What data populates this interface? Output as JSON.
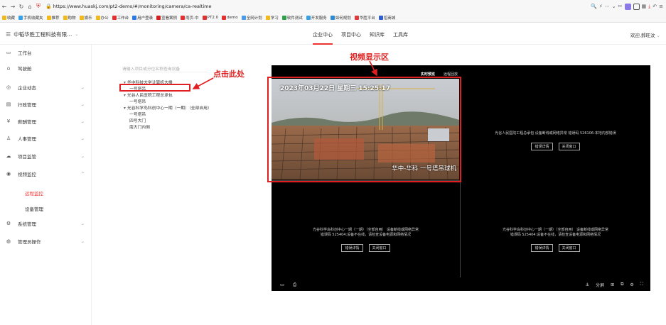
{
  "browser": {
    "url": "https://www.huaskj.com/pt2-demo/#/monitoring/camera/ca-realtime",
    "bookmarks": [
      "收藏",
      "手机收藏夹",
      "推荐",
      "购物",
      "娱乐",
      "办公",
      "工作台",
      "用户登录",
      "宣看案例",
      "雨页-中",
      "PT2.0",
      "demo",
      "全网计划",
      "学习",
      "软件测试",
      "开发服务",
      "如何规划",
      "华胜平台",
      "招商城"
    ]
  },
  "header": {
    "company": "中韬华胜工程科技有限...",
    "nav": [
      "企业中心",
      "项目中心",
      "知识库",
      "工具库"
    ],
    "active_nav": "企业中心",
    "welcome": "欢迎,郝旺汶"
  },
  "sidebar": {
    "items": [
      {
        "label": "工作台",
        "icon": "monitor-icon",
        "chev": false
      },
      {
        "label": "驾驶舱",
        "icon": "home-icon",
        "chev": false
      },
      {
        "label": "企业动态",
        "icon": "globe-icon",
        "chev": true
      },
      {
        "label": "行政管理",
        "icon": "briefcase-icon",
        "chev": true
      },
      {
        "label": "薪酬管理",
        "icon": "money-icon",
        "chev": true
      },
      {
        "label": "人事管理",
        "icon": "people-icon",
        "chev": true
      },
      {
        "label": "项目监管",
        "icon": "cloud-icon",
        "chev": true
      },
      {
        "label": "视频监控",
        "icon": "video-icon",
        "chev": true
      },
      {
        "label": "系统管理",
        "icon": "settings-icon",
        "chev": true
      },
      {
        "label": "管理员操作",
        "icon": "admin-icon",
        "chev": true
      }
    ],
    "sub_items": [
      "远程监控",
      "设备管理"
    ]
  },
  "tree": {
    "placeholder": "请输入项目或分位名称查询设备",
    "nodes": [
      {
        "label": "华中科技大学计算机大楼",
        "level": 0
      },
      {
        "label": "一号塔吊",
        "level": 1,
        "selected": true
      },
      {
        "label": "光谷人民医院工程总承包",
        "level": 0
      },
      {
        "label": "一号塔吊",
        "level": 1
      },
      {
        "label": "光谷科学岛科创中心一期（一期）（全部自用）",
        "level": 0
      },
      {
        "label": "一号塔吊",
        "level": 1
      },
      {
        "label": "四号大门",
        "level": 1
      },
      {
        "label": "南大门内侧",
        "level": 1
      }
    ]
  },
  "video": {
    "tabs": [
      "实时预览",
      "远程回放"
    ],
    "active_tab": "实时预览",
    "camera_time": "2023年03月22日 星期三 15:25:17",
    "camera_caption": "华中-华科 一号塔吊球机",
    "cells": [
      {
        "msg1": "光谷人民医院工程总承包  设备断线或网络异常 错误码 526106:本地内部错误",
        "msg2": ""
      },
      {
        "msg1": "光谷科学岛科创中心一期（一期）（全部自用）  设备断线或网络异常",
        "msg2": "错误码 525404:设备不在线，请检查设备电源和网络情况"
      },
      {
        "msg1": "光谷科学岛科创中心一期（一期）（全部自用）  设备断线或网络异常",
        "msg2": "错误码 525404:设备不在线，请检查设备电源和网络情况"
      }
    ],
    "btn_error": "错误详情",
    "btn_close": "关闭窗口",
    "bottom_right": [
      "⚓",
      "分屏",
      "⊞",
      "⧉",
      "⚙",
      "⛶"
    ]
  },
  "annotations": {
    "video_area": "视频显示区",
    "click_here": "点击此处"
  },
  "colors": {
    "accent": "#e33333",
    "annotation": "#e02020"
  }
}
